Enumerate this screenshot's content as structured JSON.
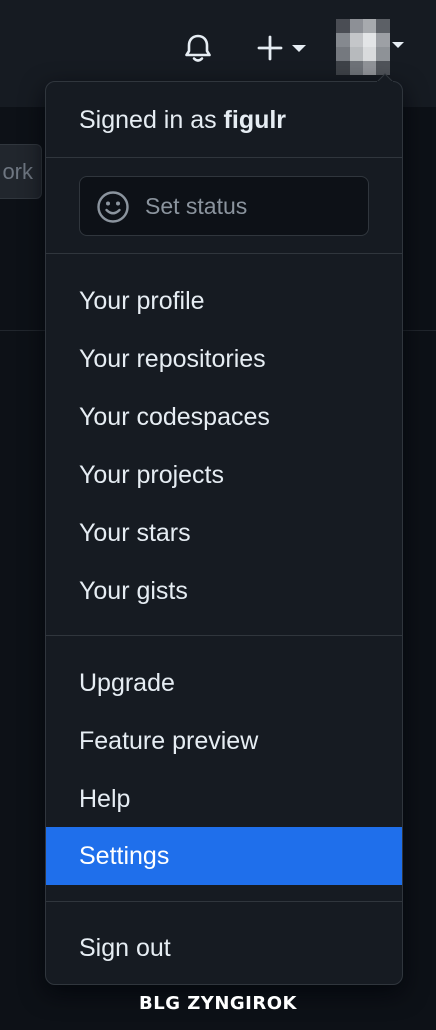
{
  "header": {
    "notifications_icon": "bell-icon",
    "create_icon": "plus-icon",
    "avatar_icon": "avatar",
    "dropdown_icon": "caret-down-icon"
  },
  "background": {
    "partial_button_label": "ork"
  },
  "menu": {
    "signed_in_prefix": "Signed in as ",
    "username": "figulr",
    "set_status_label": "Set status",
    "set_status_icon": "smiley-icon",
    "group1": [
      {
        "label": "Your profile"
      },
      {
        "label": "Your repositories"
      },
      {
        "label": "Your codespaces"
      },
      {
        "label": "Your projects"
      },
      {
        "label": "Your stars"
      },
      {
        "label": "Your gists"
      }
    ],
    "group2": [
      {
        "label": "Upgrade"
      },
      {
        "label": "Feature preview"
      },
      {
        "label": "Help"
      },
      {
        "label": "Settings",
        "active": true
      }
    ],
    "sign_out_label": "Sign out"
  },
  "colors": {
    "page_bg": "#0d1117",
    "header_bg": "#161b22",
    "menu_bg": "#161b22",
    "border": "#30363d",
    "active_bg": "#1f6feb",
    "text": "#e6edf3",
    "muted_text": "#8b949e"
  },
  "watermark": "BLG ZYNGIROK"
}
